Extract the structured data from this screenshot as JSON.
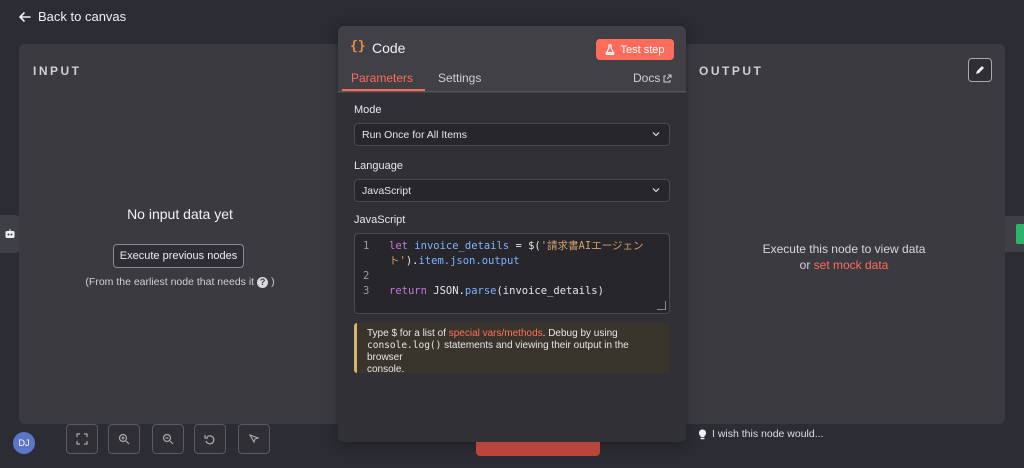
{
  "topbar": {
    "back_label": "Back to canvas"
  },
  "input_panel": {
    "title": "INPUT",
    "empty_title": "No input data yet",
    "execute_button": "Execute previous nodes",
    "hint_text": "(From the earliest node that needs it",
    "hint_close": ")"
  },
  "output_panel": {
    "title": "OUTPUT",
    "message_line1": "Execute this node to view data",
    "message_or": "or",
    "mock_link": "set mock data"
  },
  "node": {
    "icon_text": "{}",
    "title": "Code",
    "test_button": "Test step",
    "tabs": {
      "parameters": "Parameters",
      "settings": "Settings",
      "docs": "Docs"
    }
  },
  "params": {
    "mode_label": "Mode",
    "mode_value": "Run Once for All Items",
    "language_label": "Language",
    "language_value": "JavaScript",
    "code_label": "JavaScript",
    "code": {
      "line1_num": "1",
      "line1_kw": "let",
      "line1_var": "invoice_details",
      "line1_eq": " = $(",
      "line1_str": "'請求書AIエージェン",
      "line1b_str": "ト'",
      "line1b_rest": ").",
      "line1b_prop": "item.json.output",
      "line2_num": "2",
      "line3_num": "3",
      "line3_kw": "return",
      "line3_obj": " JSON.",
      "line3_fn": "parse",
      "line3_arg": "(invoice_details)"
    },
    "notice": {
      "part1": "Type $ for a list of ",
      "link": "special vars/methods",
      "part2": ". Debug by using",
      "mono": "console.log()",
      "part3": " statements and viewing their output in the browser",
      "part4": "console."
    }
  },
  "footer": {
    "avatar": "DJ",
    "wish": "I wish this node would..."
  },
  "colors": {
    "accent": "#ff6d5a",
    "background": "#2c2c34",
    "panel": "#3a3a40"
  }
}
